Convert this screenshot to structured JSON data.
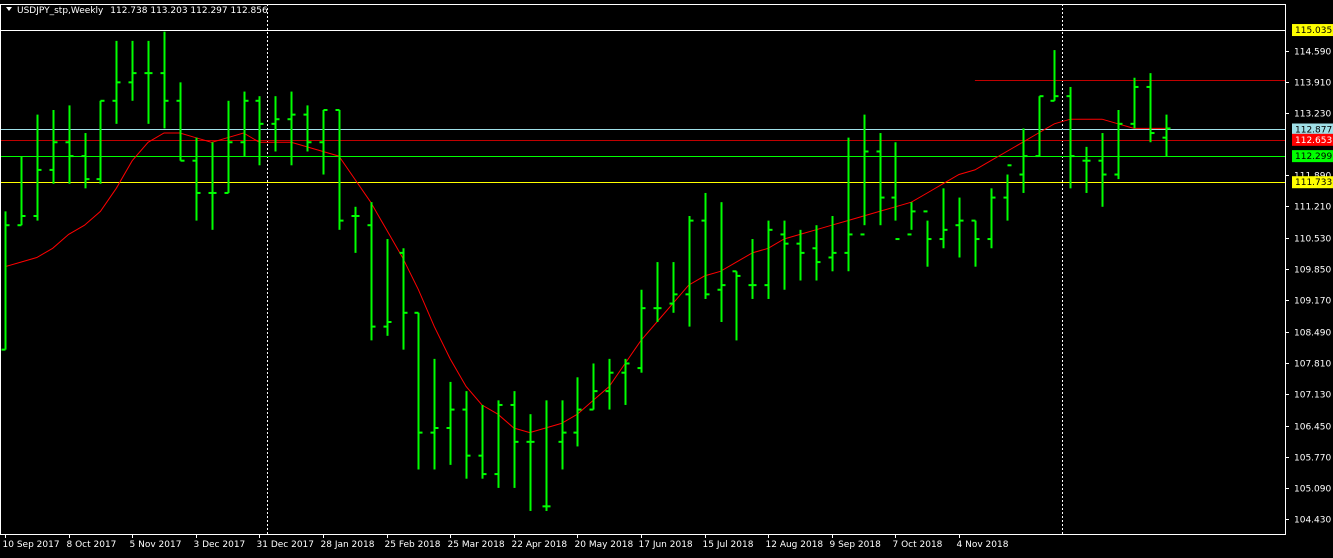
{
  "header": {
    "symbol": "USDJPY_stp,Weekly",
    "ohlc": "112.738 113.203 112.297 112.856"
  },
  "colors": {
    "background": "#000000",
    "axis": "#ffffff",
    "bar": "#00ff00",
    "ma_line": "#ff0000",
    "level_cyan": "#a0e0e8",
    "level_red": "#ff0000",
    "level_green": "#00ff00",
    "level_yellow": "#ffff00",
    "top_line": "#ffffff",
    "resistance_red": "#c00000"
  },
  "chart_data": {
    "type": "ohlc",
    "title": "USDJPY_stp,Weekly",
    "ylim": [
      104.1,
      115.6
    ],
    "price_ticks": [
      "114.590",
      "113.910",
      "113.230",
      "111.890",
      "111.210",
      "110.530",
      "109.850",
      "109.170",
      "108.490",
      "107.810",
      "107.130",
      "106.450",
      "105.770",
      "105.090",
      "104.430"
    ],
    "price_tick_values": [
      114.59,
      113.91,
      113.23,
      111.89,
      111.21,
      110.53,
      109.85,
      109.17,
      108.49,
      107.81,
      107.13,
      106.45,
      105.77,
      105.09,
      104.43
    ],
    "date_labels": [
      {
        "label": "10 Sep 2017",
        "index": 0
      },
      {
        "label": "8 Oct 2017",
        "index": 4
      },
      {
        "label": "5 Nov 2017",
        "index": 8
      },
      {
        "label": "3 Dec 2017",
        "index": 12
      },
      {
        "label": "31 Dec 2017",
        "index": 16
      },
      {
        "label": "28 Jan 2018",
        "index": 20
      },
      {
        "label": "25 Feb 2018",
        "index": 24
      },
      {
        "label": "25 Mar 2018",
        "index": 28
      },
      {
        "label": "22 Apr 2018",
        "index": 32
      },
      {
        "label": "20 May 2018",
        "index": 36
      },
      {
        "label": "17 Jun 2018",
        "index": 40
      },
      {
        "label": "15 Jul 2018",
        "index": 44
      },
      {
        "label": "12 Aug 2018",
        "index": 48
      },
      {
        "label": "9 Sep 2018",
        "index": 52
      },
      {
        "label": "7 Oct 2018",
        "index": 56
      },
      {
        "label": "4 Nov 2018",
        "index": 60
      }
    ],
    "period_separators": [
      16.5,
      66.5
    ],
    "bars": [
      {
        "o": 108.1,
        "h": 111.1,
        "l": 108.1,
        "c": 110.8
      },
      {
        "o": 110.8,
        "h": 112.3,
        "l": 110.8,
        "c": 111.0
      },
      {
        "o": 111.0,
        "h": 113.2,
        "l": 110.9,
        "c": 112.0
      },
      {
        "o": 112.0,
        "h": 113.3,
        "l": 111.7,
        "c": 112.6
      },
      {
        "o": 112.6,
        "h": 113.4,
        "l": 111.7,
        "c": 112.3
      },
      {
        "o": 112.3,
        "h": 112.8,
        "l": 111.6,
        "c": 111.8
      },
      {
        "o": 111.8,
        "h": 113.5,
        "l": 111.7,
        "c": 113.5
      },
      {
        "o": 113.5,
        "h": 114.8,
        "l": 113.0,
        "c": 113.9
      },
      {
        "o": 113.9,
        "h": 114.8,
        "l": 113.5,
        "c": 114.1
      },
      {
        "o": 114.1,
        "h": 114.8,
        "l": 113.0,
        "c": 114.1
      },
      {
        "o": 114.1,
        "h": 115.0,
        "l": 112.9,
        "c": 113.5
      },
      {
        "o": 113.5,
        "h": 113.9,
        "l": 112.2,
        "c": 112.2
      },
      {
        "o": 112.2,
        "h": 112.7,
        "l": 110.9,
        "c": 111.5
      },
      {
        "o": 111.5,
        "h": 112.6,
        "l": 110.7,
        "c": 111.5
      },
      {
        "o": 111.5,
        "h": 113.5,
        "l": 111.5,
        "c": 112.6
      },
      {
        "o": 112.6,
        "h": 113.7,
        "l": 112.3,
        "c": 113.5
      },
      {
        "o": 113.5,
        "h": 113.6,
        "l": 112.1,
        "c": 113.0
      },
      {
        "o": 113.0,
        "h": 113.6,
        "l": 112.4,
        "c": 113.1
      },
      {
        "o": 113.1,
        "h": 113.7,
        "l": 112.1,
        "c": 113.2
      },
      {
        "o": 113.2,
        "h": 113.4,
        "l": 112.4,
        "c": 112.6
      },
      {
        "o": 112.6,
        "h": 113.3,
        "l": 111.9,
        "c": 113.3
      },
      {
        "o": 113.3,
        "h": 113.3,
        "l": 110.7,
        "c": 110.9
      },
      {
        "o": 111.0,
        "h": 111.2,
        "l": 110.2,
        "c": 111.0
      },
      {
        "o": 110.8,
        "h": 111.3,
        "l": 108.3,
        "c": 108.6
      },
      {
        "o": 108.6,
        "h": 110.5,
        "l": 108.4,
        "c": 108.7
      },
      {
        "o": 110.2,
        "h": 110.3,
        "l": 108.1,
        "c": 108.9
      },
      {
        "o": 108.9,
        "h": 108.9,
        "l": 105.5,
        "c": 106.3
      },
      {
        "o": 106.3,
        "h": 107.9,
        "l": 105.5,
        "c": 106.4
      },
      {
        "o": 106.4,
        "h": 107.4,
        "l": 105.6,
        "c": 106.8
      },
      {
        "o": 106.8,
        "h": 107.2,
        "l": 105.3,
        "c": 105.8
      },
      {
        "o": 105.8,
        "h": 106.9,
        "l": 105.3,
        "c": 105.4
      },
      {
        "o": 105.4,
        "h": 107.0,
        "l": 105.1,
        "c": 106.9
      },
      {
        "o": 106.9,
        "h": 107.2,
        "l": 105.1,
        "c": 106.1
      },
      {
        "o": 106.1,
        "h": 106.7,
        "l": 104.6,
        "c": 106.1
      },
      {
        "o": 104.7,
        "h": 107.0,
        "l": 104.6,
        "c": 104.7
      },
      {
        "o": 106.1,
        "h": 107.0,
        "l": 105.5,
        "c": 106.3
      },
      {
        "o": 106.3,
        "h": 107.5,
        "l": 106.0,
        "c": 106.8
      },
      {
        "o": 106.8,
        "h": 107.8,
        "l": 106.8,
        "c": 107.2
      },
      {
        "o": 107.2,
        "h": 107.9,
        "l": 106.8,
        "c": 107.6
      },
      {
        "o": 107.6,
        "h": 107.9,
        "l": 106.9,
        "c": 107.8
      },
      {
        "o": 107.7,
        "h": 109.4,
        "l": 107.6,
        "c": 109.0
      },
      {
        "o": 109.0,
        "h": 110.0,
        "l": 108.7,
        "c": 109.0
      },
      {
        "o": 109.1,
        "h": 110.0,
        "l": 108.9,
        "c": 109.3
      },
      {
        "o": 109.3,
        "h": 111.0,
        "l": 108.6,
        "c": 110.9
      },
      {
        "o": 110.9,
        "h": 111.5,
        "l": 109.2,
        "c": 109.3
      },
      {
        "o": 109.4,
        "h": 111.3,
        "l": 108.7,
        "c": 109.5
      },
      {
        "o": 109.8,
        "h": 109.8,
        "l": 108.3,
        "c": 109.7
      },
      {
        "o": 109.5,
        "h": 110.5,
        "l": 109.2,
        "c": 109.5
      },
      {
        "o": 109.5,
        "h": 110.9,
        "l": 109.2,
        "c": 110.7
      },
      {
        "o": 110.6,
        "h": 110.9,
        "l": 109.4,
        "c": 110.4
      },
      {
        "o": 110.4,
        "h": 110.7,
        "l": 109.6,
        "c": 110.2
      },
      {
        "o": 110.3,
        "h": 110.8,
        "l": 109.6,
        "c": 110.0
      },
      {
        "o": 110.1,
        "h": 111.0,
        "l": 109.8,
        "c": 110.2
      },
      {
        "o": 110.2,
        "h": 112.7,
        "l": 109.8,
        "c": 110.6
      },
      {
        "o": 110.6,
        "h": 113.2,
        "l": 110.8,
        "c": 112.4
      },
      {
        "o": 112.4,
        "h": 112.8,
        "l": 110.8,
        "c": 111.4
      },
      {
        "o": 111.4,
        "h": 112.6,
        "l": 110.9,
        "c": 110.5
      },
      {
        "o": 110.6,
        "h": 111.3,
        "l": 110.7,
        "c": 111.1
      },
      {
        "o": 111.1,
        "h": 110.9,
        "l": 109.9,
        "c": 110.5
      },
      {
        "o": 110.5,
        "h": 111.6,
        "l": 110.3,
        "c": 110.7
      },
      {
        "o": 110.8,
        "h": 111.4,
        "l": 110.1,
        "c": 110.9
      },
      {
        "o": 110.9,
        "h": 110.9,
        "l": 109.9,
        "c": 110.5
      },
      {
        "o": 110.5,
        "h": 111.6,
        "l": 110.3,
        "c": 111.4
      },
      {
        "o": 111.4,
        "h": 111.9,
        "l": 110.9,
        "c": 112.1
      },
      {
        "o": 111.9,
        "h": 112.9,
        "l": 111.5,
        "c": 112.3
      },
      {
        "o": 112.3,
        "h": 113.6,
        "l": 112.3,
        "c": 113.6
      },
      {
        "o": 113.5,
        "h": 114.6,
        "l": 113.5,
        "c": 113.6
      },
      {
        "o": 113.6,
        "h": 113.8,
        "l": 111.6,
        "c": 112.3
      },
      {
        "o": 112.2,
        "h": 112.5,
        "l": 111.5,
        "c": 112.2
      },
      {
        "o": 112.2,
        "h": 112.8,
        "l": 111.2,
        "c": 111.9
      },
      {
        "o": 111.9,
        "h": 113.3,
        "l": 111.8,
        "c": 113.0
      },
      {
        "o": 113.0,
        "h": 114.0,
        "l": 112.9,
        "c": 113.8
      },
      {
        "o": 113.8,
        "h": 114.1,
        "l": 112.6,
        "c": 112.8
      },
      {
        "o": 112.7,
        "h": 113.2,
        "l": 112.3,
        "c": 112.9
      }
    ],
    "ma": [
      109.9,
      110.0,
      110.1,
      110.3,
      110.6,
      110.8,
      111.1,
      111.6,
      112.2,
      112.6,
      112.8,
      112.8,
      112.7,
      112.6,
      112.7,
      112.8,
      112.6,
      112.6,
      112.6,
      112.5,
      112.4,
      112.3,
      111.8,
      111.3,
      110.7,
      110.1,
      109.4,
      108.6,
      107.9,
      107.3,
      106.9,
      106.7,
      106.4,
      106.3,
      106.4,
      106.5,
      106.7,
      107.0,
      107.3,
      107.8,
      108.3,
      108.7,
      109.1,
      109.5,
      109.7,
      109.8,
      110.0,
      110.2,
      110.3,
      110.5,
      110.6,
      110.7,
      110.8,
      110.9,
      111.0,
      111.1,
      111.2,
      111.3,
      111.5,
      111.7,
      111.9,
      112.0,
      112.2,
      112.4,
      112.6,
      112.8,
      113.0,
      113.1,
      113.1,
      113.1,
      113.0,
      112.9,
      112.9,
      112.9
    ],
    "levels": [
      {
        "value": 115.035,
        "label": "115.035",
        "color": "#ffff00",
        "text_color": "#000000",
        "line_color": "#ffffff"
      },
      {
        "value": 112.877,
        "label": "112.877",
        "color": "#a0e0e8",
        "text_color": "#000000",
        "line_color": "#a0e0e8"
      },
      {
        "value": 112.653,
        "label": "112.653",
        "color": "#ff0000",
        "text_color": "#ffffff",
        "line_color": "#c00000"
      },
      {
        "value": 112.299,
        "label": "112.299",
        "color": "#00ff00",
        "text_color": "#000000",
        "line_color": "#00ff00"
      },
      {
        "value": 111.733,
        "label": "111.733",
        "color": "#ffff00",
        "text_color": "#000000",
        "line_color": "#ffff00"
      }
    ],
    "resistance": {
      "value": 113.95,
      "from_index": 61
    }
  }
}
